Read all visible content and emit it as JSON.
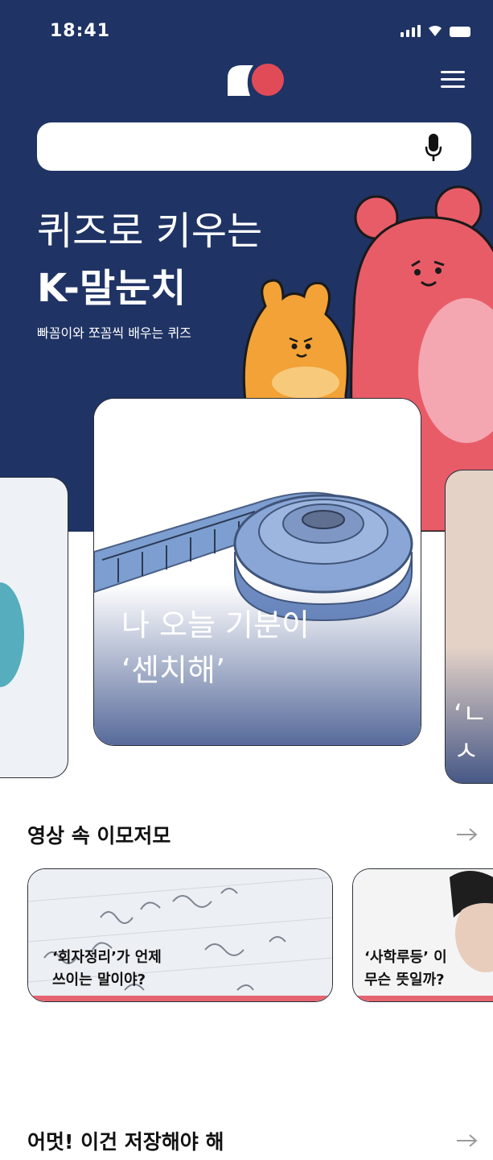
{
  "status_bar": {
    "time": "18:41"
  },
  "header": {
    "logo_icon": "brand-logo-icon",
    "menu_icon": "hamburger-menu-icon"
  },
  "search": {
    "placeholder": "",
    "value": "",
    "mic_icon": "microphone-icon"
  },
  "hero": {
    "line1": "퀴즈로 키우는",
    "line2": "K-말눈치",
    "subtitle": "빠꼼이와 쪼꼼씩 배우는 퀴즈"
  },
  "carousel": {
    "main_card": {
      "title_line1": "나 오늘 기분이",
      "title_line2": "‘센치해’"
    },
    "right_peek": {
      "text": "‘ㄴ\nㅅ"
    }
  },
  "sections": {
    "videos": {
      "title": "영상 속 이모저모",
      "cards": [
        {
          "title": "‘회자정리’가 언제\n쓰이는 말이야?"
        },
        {
          "title": "‘사학루등’ 이\n무슨 뜻일까?"
        }
      ]
    },
    "saved": {
      "title": "어멋! 이건 저장해야 해"
    }
  },
  "colors": {
    "hero_bg": "#1f3364",
    "accent_red": "#e56470",
    "bear_pink": "#e85c68",
    "bear_orange": "#f2a236"
  }
}
